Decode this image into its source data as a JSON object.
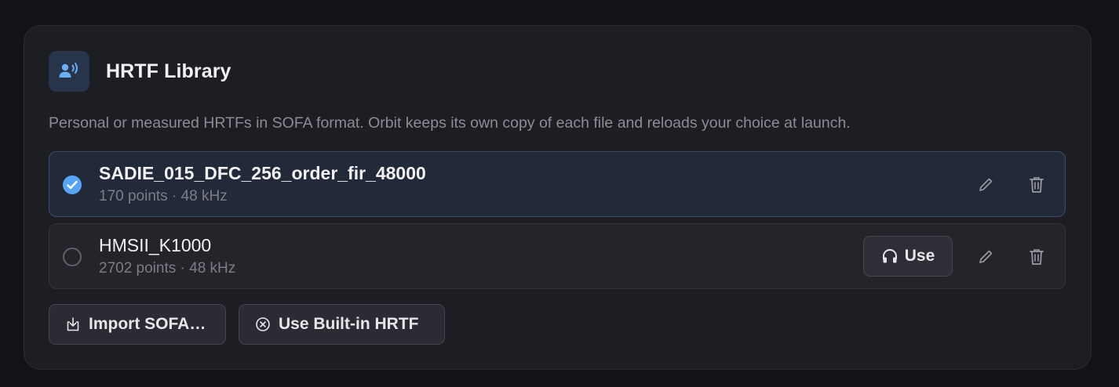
{
  "header": {
    "title": "HRTF Library",
    "icon": "person-speaking-icon",
    "accent": "#58a4f5"
  },
  "description": "Personal or measured HRTFs in SOFA format. Orbit keeps its own copy of each file and reloads your choice at launch.",
  "hrtfs": [
    {
      "name": "SADIE_015_DFC_256_order_fir_48000",
      "meta": "170 points · 48 kHz",
      "selected": true
    },
    {
      "name": "HMSII_K1000",
      "meta": "2702 points · 48 kHz",
      "selected": false,
      "use_label": "Use"
    }
  ],
  "actions": {
    "import_label": "Import SOFA…",
    "builtin_label": "Use Built-in HRTF"
  },
  "icons": {
    "edit": "pencil-icon",
    "delete": "trash-icon",
    "use": "headphones-icon",
    "import": "import-icon",
    "builtin": "circle-x-icon"
  }
}
